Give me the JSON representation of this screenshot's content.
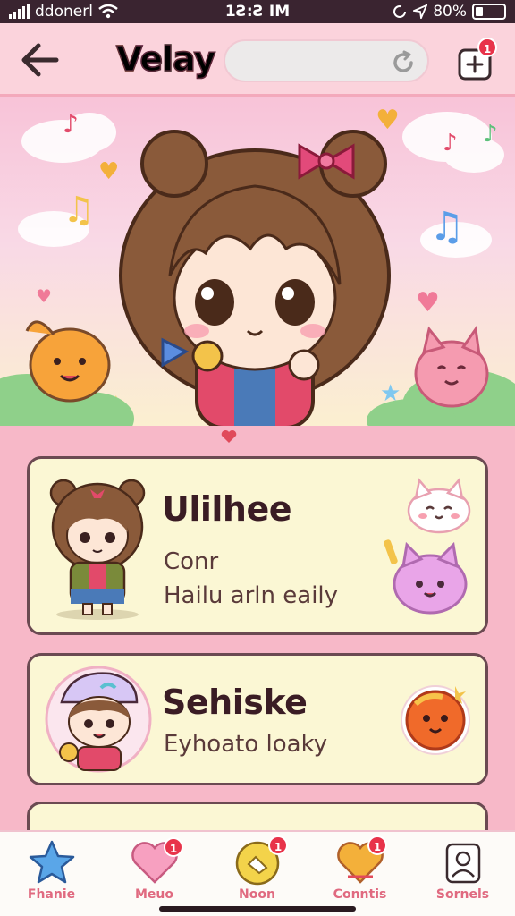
{
  "status_bar": {
    "carrier": "ddonerl",
    "time": "1Ƨ:Ƨ IM",
    "battery": "80%"
  },
  "header": {
    "logo_text": "Velay",
    "search_value": "",
    "notification_count": "1"
  },
  "cards": [
    {
      "title": "Ulilhee",
      "line1": "Conr",
      "line2": "Hailu arln eaily"
    },
    {
      "title": "Sehiske",
      "line1": "Eyhoato loaky"
    }
  ],
  "bottom_nav": [
    {
      "label": "Fhanie",
      "icon": "star-icon",
      "badge": ""
    },
    {
      "label": "Meuo",
      "icon": "heart-icon",
      "badge": "1"
    },
    {
      "label": "Noon",
      "icon": "badge-circle-icon",
      "badge": "1"
    },
    {
      "label": "Conntis",
      "icon": "heart-gold-icon",
      "badge": "1"
    },
    {
      "label": "Sornels",
      "icon": "profile-card-icon",
      "badge": ""
    }
  ],
  "colors": {
    "accent_pink": "#f7b8c8",
    "badge_red": "#e8334a",
    "card_bg": "#fbf7d4",
    "nav_label": "#e06a80"
  }
}
